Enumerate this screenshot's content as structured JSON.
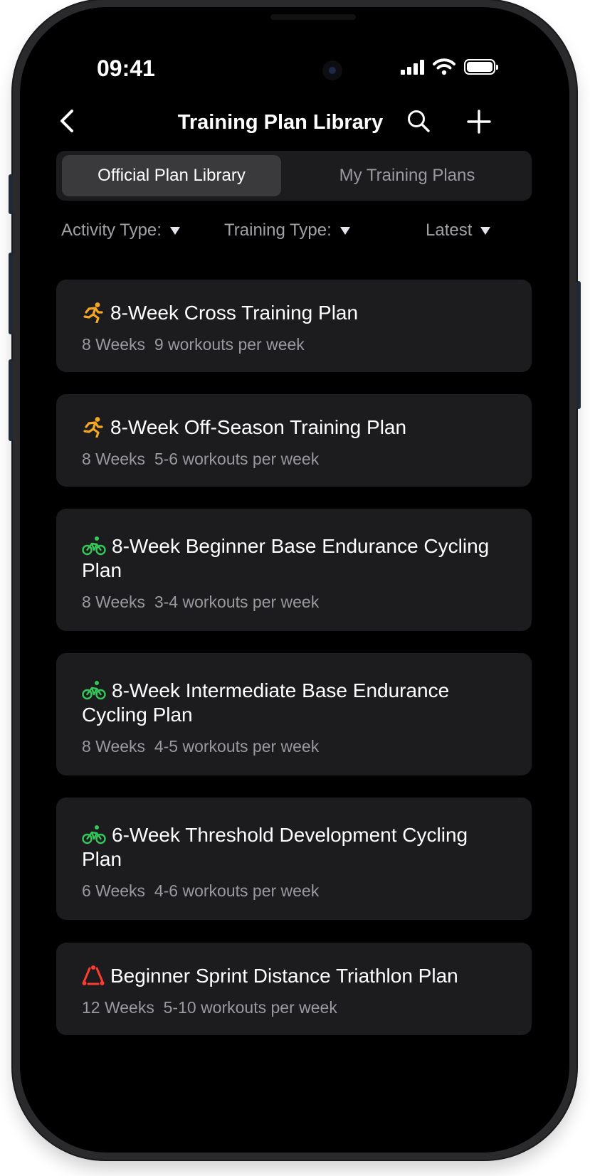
{
  "status_bar": {
    "time": "09:41"
  },
  "nav": {
    "title": "Training Plan Library"
  },
  "tabs": [
    {
      "label": "Official Plan Library",
      "active": true
    },
    {
      "label": "My Training Plans",
      "active": false
    }
  ],
  "filters": {
    "activity_type": "Activity Type:",
    "training_type": "Training Type:",
    "sort": "Latest"
  },
  "colors": {
    "running": "#f5a623",
    "cycling": "#34c759",
    "triathlon": "#ff3b30"
  },
  "plans": [
    {
      "icon": "running-icon",
      "title": "8-Week Cross Training Plan",
      "duration": "8 Weeks",
      "frequency": "9 workouts per week"
    },
    {
      "icon": "running-icon",
      "title": "8-Week Off-Season Training Plan",
      "duration": "8 Weeks",
      "frequency": "5-6 workouts per week"
    },
    {
      "icon": "cycling-icon",
      "title": "8-Week Beginner Base Endurance Cycling Plan",
      "duration": "8 Weeks",
      "frequency": "3-4 workouts per week"
    },
    {
      "icon": "cycling-icon",
      "title": "8-Week Intermediate Base Endurance Cycling Plan",
      "duration": "8 Weeks",
      "frequency": "4-5 workouts per week"
    },
    {
      "icon": "cycling-icon",
      "title": "6-Week Threshold Development Cycling Plan",
      "duration": "6 Weeks",
      "frequency": "4-6 workouts per week"
    },
    {
      "icon": "triathlon-icon",
      "title": "Beginner Sprint Distance Triathlon Plan",
      "duration": "12 Weeks",
      "frequency": "5-10 workouts per week"
    }
  ]
}
